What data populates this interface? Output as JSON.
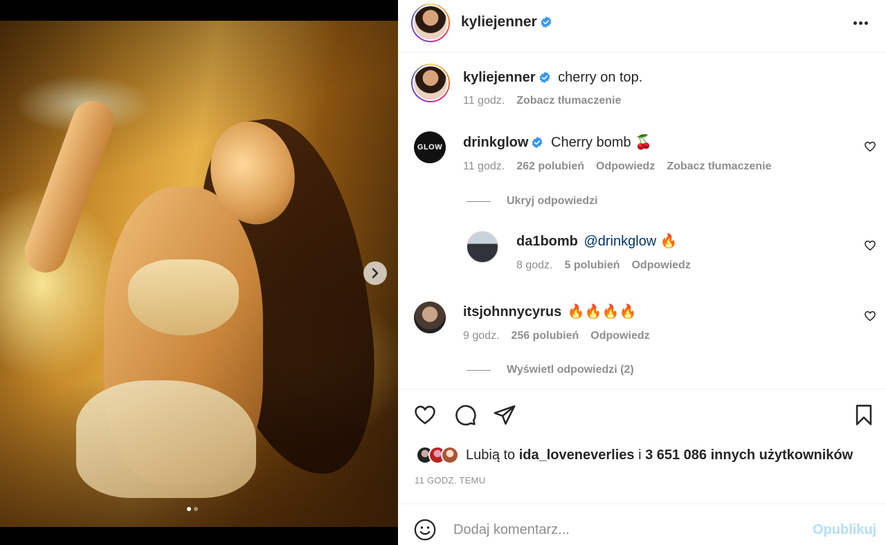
{
  "post": {
    "author": "kyliejenner",
    "caption": "cherry on top.",
    "caption_time": "11 godz.",
    "see_translation": "Zobacz tłumaczenie",
    "carousel": {
      "total": 2,
      "current": 1
    }
  },
  "header": {
    "username": "kyliejenner",
    "verified": true,
    "more_icon": "more-horizontal-icon"
  },
  "comments": [
    {
      "username": "drinkglow",
      "verified": true,
      "avatar_text": "GLOW",
      "text": "Cherry bomb 🍒",
      "time": "11 godz.",
      "likes": "262 polubień",
      "reply": "Odpowiedz",
      "translate": "Zobacz tłumaczenie",
      "toggle_replies": "Ukryj odpowiedzi",
      "replies": [
        {
          "username": "da1bomb",
          "mention": "@drinkglow",
          "emoji": "🔥",
          "time": "8 godz.",
          "likes": "5 polubień",
          "reply": "Odpowiedz"
        }
      ]
    },
    {
      "username": "itsjohnnycyrus",
      "text": "🔥🔥🔥🔥",
      "time": "9 godz.",
      "likes": "256 polubień",
      "reply": "Odpowiedz",
      "toggle_replies": "Wyświetl odpowiedzi (2)"
    }
  ],
  "likes": {
    "prefix": "Lubią to ",
    "user": "ida_loveneverlies",
    "middle": " i ",
    "others": "3 651 086 innych użytkowników"
  },
  "timestamp": "11 GODZ. TEMU",
  "add_comment": {
    "placeholder": "Dodaj komentarz...",
    "publish": "Opublikuj"
  },
  "colors": {
    "accent": "#0095f6",
    "publish_disabled": "#b2dffc",
    "verified": "#3897f0",
    "meta": "#8e8e8e",
    "mention": "#00376b"
  }
}
